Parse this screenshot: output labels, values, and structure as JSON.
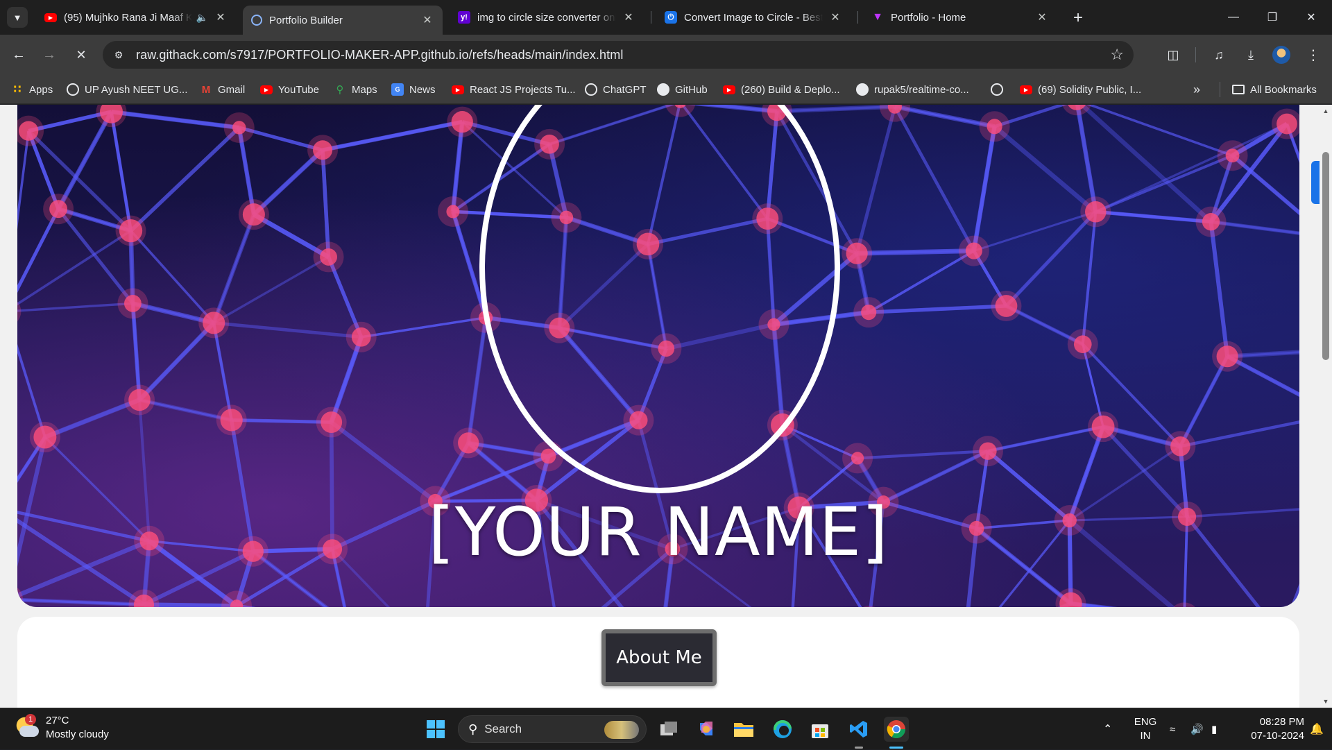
{
  "browser": {
    "tabs": [
      {
        "title": "(95) Mujhko Rana Ji Maaf K",
        "favicon": "youtube-icon",
        "audio": true,
        "active": false
      },
      {
        "title": "Portfolio Builder",
        "favicon": "loading-icon",
        "audio": false,
        "active": true
      },
      {
        "title": "img to circle size converter onli",
        "favicon": "yahoo-icon",
        "audio": false,
        "active": false
      },
      {
        "title": "Convert Image to Circle - Best I",
        "favicon": "power-icon",
        "audio": false,
        "active": false
      },
      {
        "title": "Portfolio - Home",
        "favicon": "vite-icon",
        "audio": false,
        "active": false
      }
    ],
    "url": "raw.githack.com/s7917/PORTFOLIO-MAKER-APP.github.io/refs/heads/main/index.html",
    "bookmarks": [
      {
        "label": "Apps",
        "icon": "apps-grid-icon"
      },
      {
        "label": "UP Ayush NEET UG...",
        "icon": "globe-icon"
      },
      {
        "label": "Gmail",
        "icon": "gmail-icon"
      },
      {
        "label": "YouTube",
        "icon": "youtube-icon"
      },
      {
        "label": "Maps",
        "icon": "maps-icon"
      },
      {
        "label": "News",
        "icon": "news-icon"
      },
      {
        "label": "React JS Projects Tu...",
        "icon": "youtube-icon"
      },
      {
        "label": "ChatGPT",
        "icon": "chatgpt-icon"
      },
      {
        "label": "GitHub",
        "icon": "github-icon"
      },
      {
        "label": "(260) Build & Deplo...",
        "icon": "youtube-icon"
      },
      {
        "label": "rupak5/realtime-co...",
        "icon": "github-icon"
      },
      {
        "label": "",
        "icon": "globe-icon"
      },
      {
        "label": "(69) Solidity Public, I...",
        "icon": "youtube-icon"
      }
    ],
    "all_bookmarks_label": "All Bookmarks"
  },
  "page": {
    "hero_name": "[YOUR NAME]",
    "about_button": "About Me"
  },
  "taskbar": {
    "weather": {
      "temp": "27°C",
      "condition": "Mostly cloudy",
      "badge": "1"
    },
    "search_label": "Search",
    "lang_line1": "ENG",
    "lang_line2": "IN",
    "time": "08:28 PM",
    "date": "07-10-2024"
  },
  "colors": {
    "tab_strip": "#1f1f1f",
    "toolbar": "#3c3c3c",
    "page_bg": "#f1f1f1",
    "network_line": "#5a5cff",
    "network_node": "#ff4d7a",
    "accent": "#1a73e8"
  }
}
